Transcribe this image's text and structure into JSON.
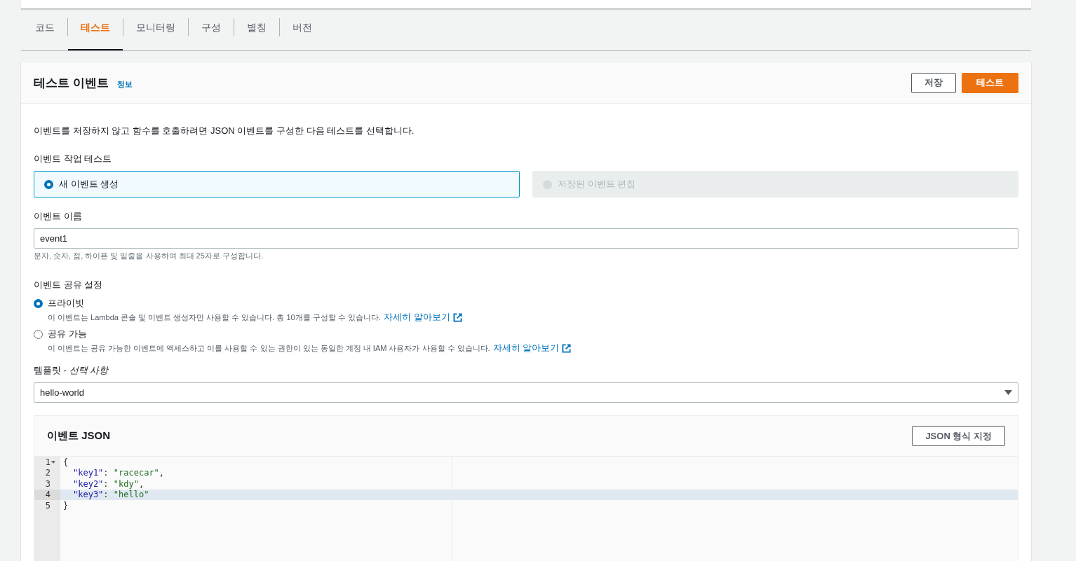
{
  "tabs": [
    {
      "label": "코드",
      "selected": false
    },
    {
      "label": "테스트",
      "selected": true
    },
    {
      "label": "모니터링",
      "selected": false
    },
    {
      "label": "구성",
      "selected": false
    },
    {
      "label": "별칭",
      "selected": false
    },
    {
      "label": "버전",
      "selected": false
    }
  ],
  "panel": {
    "title": "테스트 이벤트",
    "info_link": "정보",
    "buttons": [
      {
        "label": "저장",
        "kind": "secondary"
      },
      {
        "label": "테스트",
        "kind": "primary"
      }
    ],
    "description": "이벤트를 저장하지 않고 함수를 호출하려면 JSON 이벤트를 구성한 다음 테스트를 선택합니다.",
    "action_label": "이벤트 작업 테스트",
    "actions": [
      {
        "label": "새 이벤트 생성",
        "selected": true,
        "disabled": false
      },
      {
        "label": "저장된 이벤트 편집",
        "selected": false,
        "disabled": true
      }
    ],
    "name_label": "이벤트 이름",
    "name_value": "event1",
    "name_hint": "문자, 숫자, 점, 하이픈 및 밑줄을 사용하여 최대 25자로 구성합니다.",
    "sharing_label": "이벤트 공유 설정",
    "sharing": [
      {
        "label": "프라이빗",
        "selected": true,
        "description": "이 이벤트는 Lambda 콘솔 및 이벤트 생성자만 사용할 수 있습니다. 총 10개를 구성할 수 있습니다.",
        "link": "자세히 알아보기"
      },
      {
        "label": "공유 가능",
        "selected": false,
        "description": "이 이벤트는 공유 가능한 이벤트에 액세스하고 이를 사용할 수 있는 권한이 있는 동일한 계정 내 IAM 사용자가 사용할 수 있습니다.",
        "link": "자세히 알아보기"
      }
    ],
    "template_label": "템플릿 - ",
    "template_label_optional": "선택 사항",
    "template_value": "hello-world",
    "json_editor": {
      "title": "이벤트 JSON",
      "format_button": "JSON 형식 지정",
      "lines": [
        {
          "number": "1",
          "fold_marker": true,
          "indented": false,
          "selected": false,
          "tokens": [
            {
              "kind": "punct",
              "text": "{"
            }
          ]
        },
        {
          "number": "2",
          "fold_marker": false,
          "indented": true,
          "selected": false,
          "tokens": [
            {
              "kind": "key",
              "text": "\"key1\""
            },
            {
              "kind": "punct",
              "text": ": "
            },
            {
              "kind": "string",
              "text": "\"racecar\""
            },
            {
              "kind": "punct",
              "text": ","
            }
          ]
        },
        {
          "number": "3",
          "fold_marker": false,
          "indented": true,
          "selected": false,
          "tokens": [
            {
              "kind": "key",
              "text": "\"key2\""
            },
            {
              "kind": "punct",
              "text": ": "
            },
            {
              "kind": "string",
              "text": "\"kdy\""
            },
            {
              "kind": "punct",
              "text": ","
            }
          ]
        },
        {
          "number": "4",
          "fold_marker": false,
          "indented": true,
          "selected": true,
          "tokens": [
            {
              "kind": "key",
              "text": "\"key3\""
            },
            {
              "kind": "punct",
              "text": ": "
            },
            {
              "kind": "string",
              "text": "\"hello\""
            }
          ]
        },
        {
          "number": "5",
          "fold_marker": false,
          "indented": false,
          "selected": false,
          "tokens": [
            {
              "kind": "punct",
              "text": "}"
            }
          ]
        }
      ]
    }
  }
}
